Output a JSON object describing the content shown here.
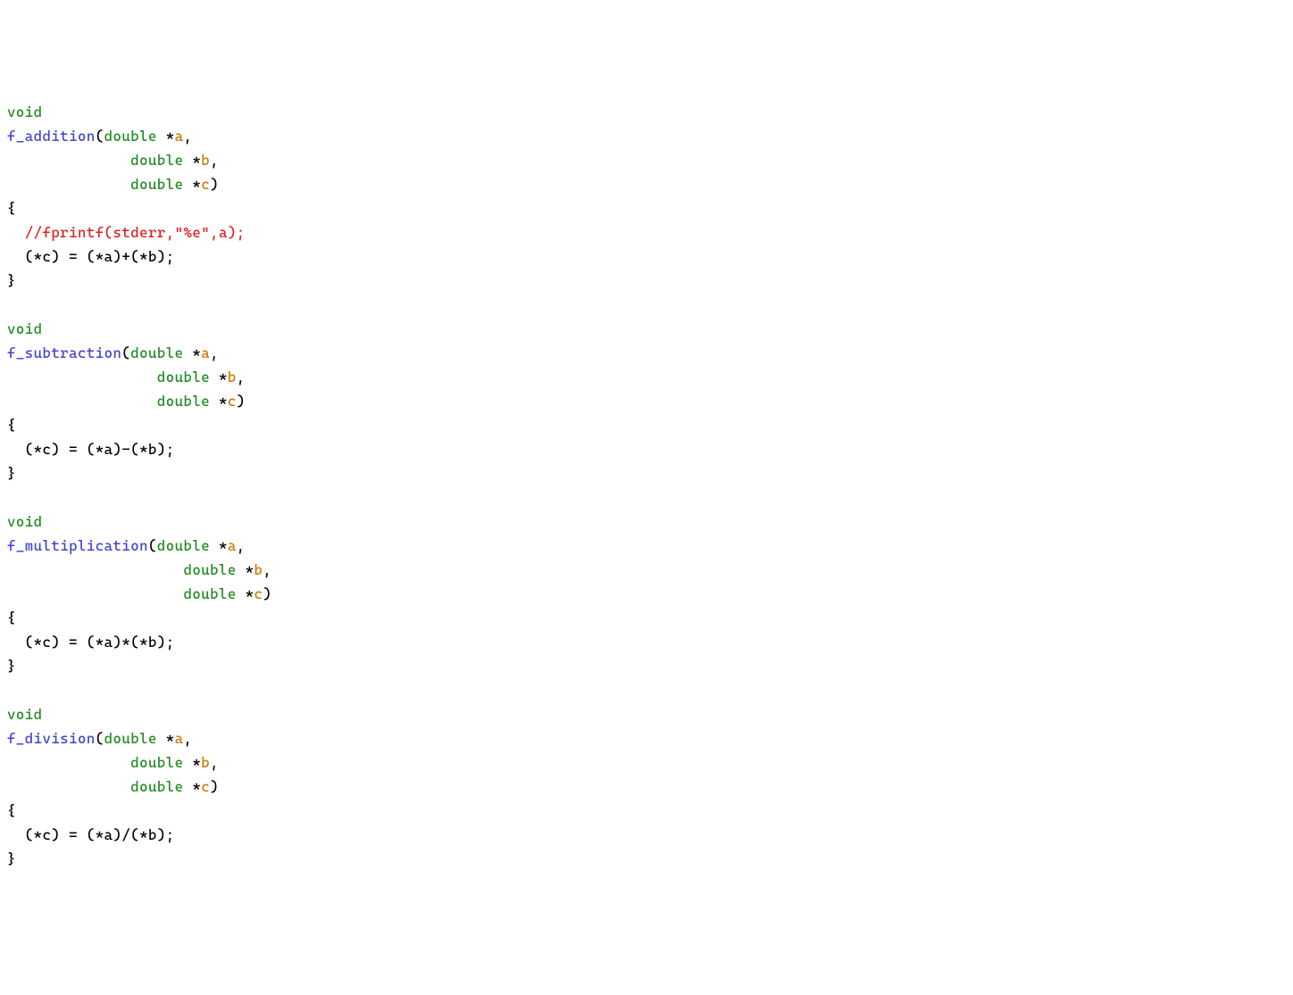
{
  "code": {
    "f1": {
      "ret": "void",
      "name": "f_addition",
      "p1a": "(",
      "p1b": "double",
      "p1c": " *",
      "p1d": "a",
      "p1e": ",",
      "p2a": "              ",
      "p2b": "double",
      "p2c": " *",
      "p2d": "b",
      "p2e": ",",
      "p3a": "              ",
      "p3b": "double",
      "p3c": " *",
      "p3d": "c",
      "p3e": ")",
      "lb": "{",
      "comment": "  //fprintf(stderr,\"%e\",a);",
      "body": "  (*c) = (*a)+(*b);",
      "rb": "}"
    },
    "f2": {
      "ret": "void",
      "name": "f_subtraction",
      "p1a": "(",
      "p1b": "double",
      "p1c": " *",
      "p1d": "a",
      "p1e": ",",
      "p2a": "                 ",
      "p2b": "double",
      "p2c": " *",
      "p2d": "b",
      "p2e": ",",
      "p3a": "                 ",
      "p3b": "double",
      "p3c": " *",
      "p3d": "c",
      "p3e": ")",
      "lb": "{",
      "body": "  (*c) = (*a)-(*b);",
      "rb": "}"
    },
    "f3": {
      "ret": "void",
      "name": "f_multiplication",
      "p1a": "(",
      "p1b": "double",
      "p1c": " *",
      "p1d": "a",
      "p1e": ",",
      "p2a": "                    ",
      "p2b": "double",
      "p2c": " *",
      "p2d": "b",
      "p2e": ",",
      "p3a": "                    ",
      "p3b": "double",
      "p3c": " *",
      "p3d": "c",
      "p3e": ")",
      "lb": "{",
      "body": "  (*c) = (*a)*(*b);",
      "rb": "}"
    },
    "f4": {
      "ret": "void",
      "name": "f_division",
      "p1a": "(",
      "p1b": "double",
      "p1c": " *",
      "p1d": "a",
      "p1e": ",",
      "p2a": "              ",
      "p2b": "double",
      "p2c": " *",
      "p2d": "b",
      "p2e": ",",
      "p3a": "              ",
      "p3b": "double",
      "p3c": " *",
      "p3d": "c",
      "p3e": ")",
      "lb": "{",
      "body": "  (*c) = (*a)/(*b);",
      "rb": "}"
    }
  }
}
